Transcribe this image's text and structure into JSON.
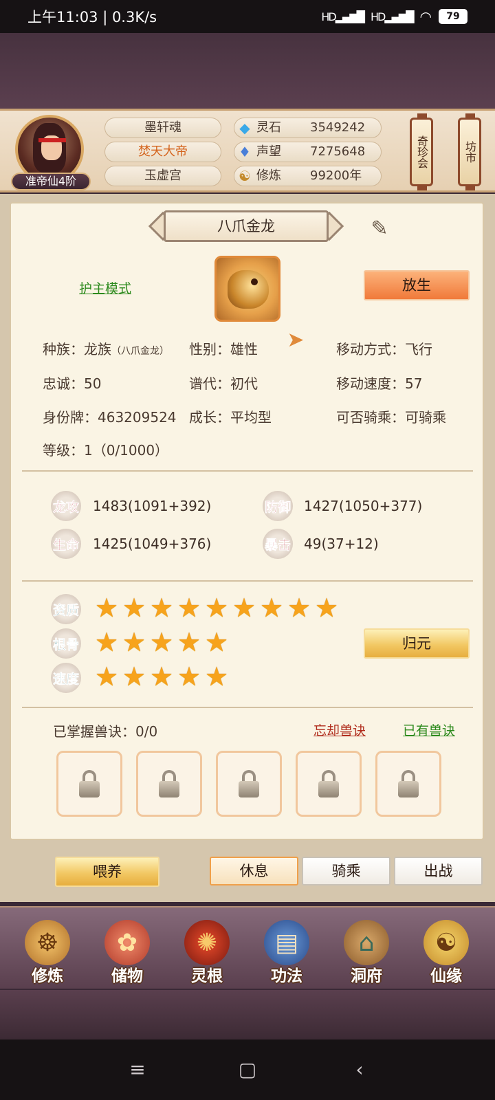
{
  "status_bar": {
    "time_speed": "上午11:03 | 0.3K/s",
    "signal1": "HD▂▄▆█",
    "signal2": "HD▂▄▆█",
    "wifi": "wifi-icon",
    "battery": "79"
  },
  "header": {
    "rank": "准帝仙4阶",
    "name_rows": [
      "墨轩魂",
      "焚天大帝",
      "玉虚宫"
    ],
    "resources": [
      {
        "icon": "spirit-stone-icon",
        "label": "灵石",
        "value": "3549242"
      },
      {
        "icon": "prestige-crystal-icon",
        "label": "声望",
        "value": "7275648"
      },
      {
        "icon": "meditation-icon",
        "label": "修炼",
        "value": "99200年"
      }
    ],
    "lantern_left": "奇珍会",
    "lantern_right": "坊市"
  },
  "pet": {
    "name": "八爪金龙",
    "mode_link": "护主模式",
    "release_button": "放生",
    "info": {
      "race": "种族：龙族",
      "race_sub": "（八爪金龙）",
      "gender": "性别：雄性",
      "move_mode": "移动方式：飞行",
      "loyalty": "忠诚：50",
      "generation": "谱代：初代",
      "move_speed": "移动速度：57",
      "id_tag": "身份牌：463209524",
      "growth": "成长：平均型",
      "rideable": "可否骑乘：可骑乘",
      "level": "等级：1（0/1000）"
    },
    "stats": [
      {
        "label": "龙攻",
        "value": "1483(1091+392)"
      },
      {
        "label": "防御",
        "value": "1427(1050+377)"
      },
      {
        "label": "生命",
        "value": "1425(1049+376)"
      },
      {
        "label": "暴击",
        "value": "49(37+12)"
      }
    ],
    "ratings": [
      {
        "label": "资质",
        "stars": 9
      },
      {
        "label": "根骨",
        "stars": 5
      },
      {
        "label": "速度",
        "stars": 5
      }
    ],
    "return_button": "归元",
    "skills_mastered": "已掌握兽诀：0/0",
    "forget_link": "忘却兽诀",
    "owned_link": "已有兽诀",
    "locked_slots": 5
  },
  "actions": {
    "feed": "喂养",
    "rest": "休息",
    "ride": "骑乘",
    "battle": "出战"
  },
  "nav": [
    {
      "label": "修炼",
      "icon": "cultivation-icon"
    },
    {
      "label": "储物",
      "icon": "storage-bag-icon"
    },
    {
      "label": "灵根",
      "icon": "spirit-root-icon"
    },
    {
      "label": "功法",
      "icon": "technique-book-icon"
    },
    {
      "label": "洞府",
      "icon": "cave-dwelling-icon"
    },
    {
      "label": "仙缘",
      "icon": "immortal-fate-icon"
    }
  ],
  "colors": {
    "accent_orange": "#f07a3a",
    "gold": "#f2c864",
    "green_link": "#2d8a1d",
    "red_link": "#b02c1c"
  }
}
